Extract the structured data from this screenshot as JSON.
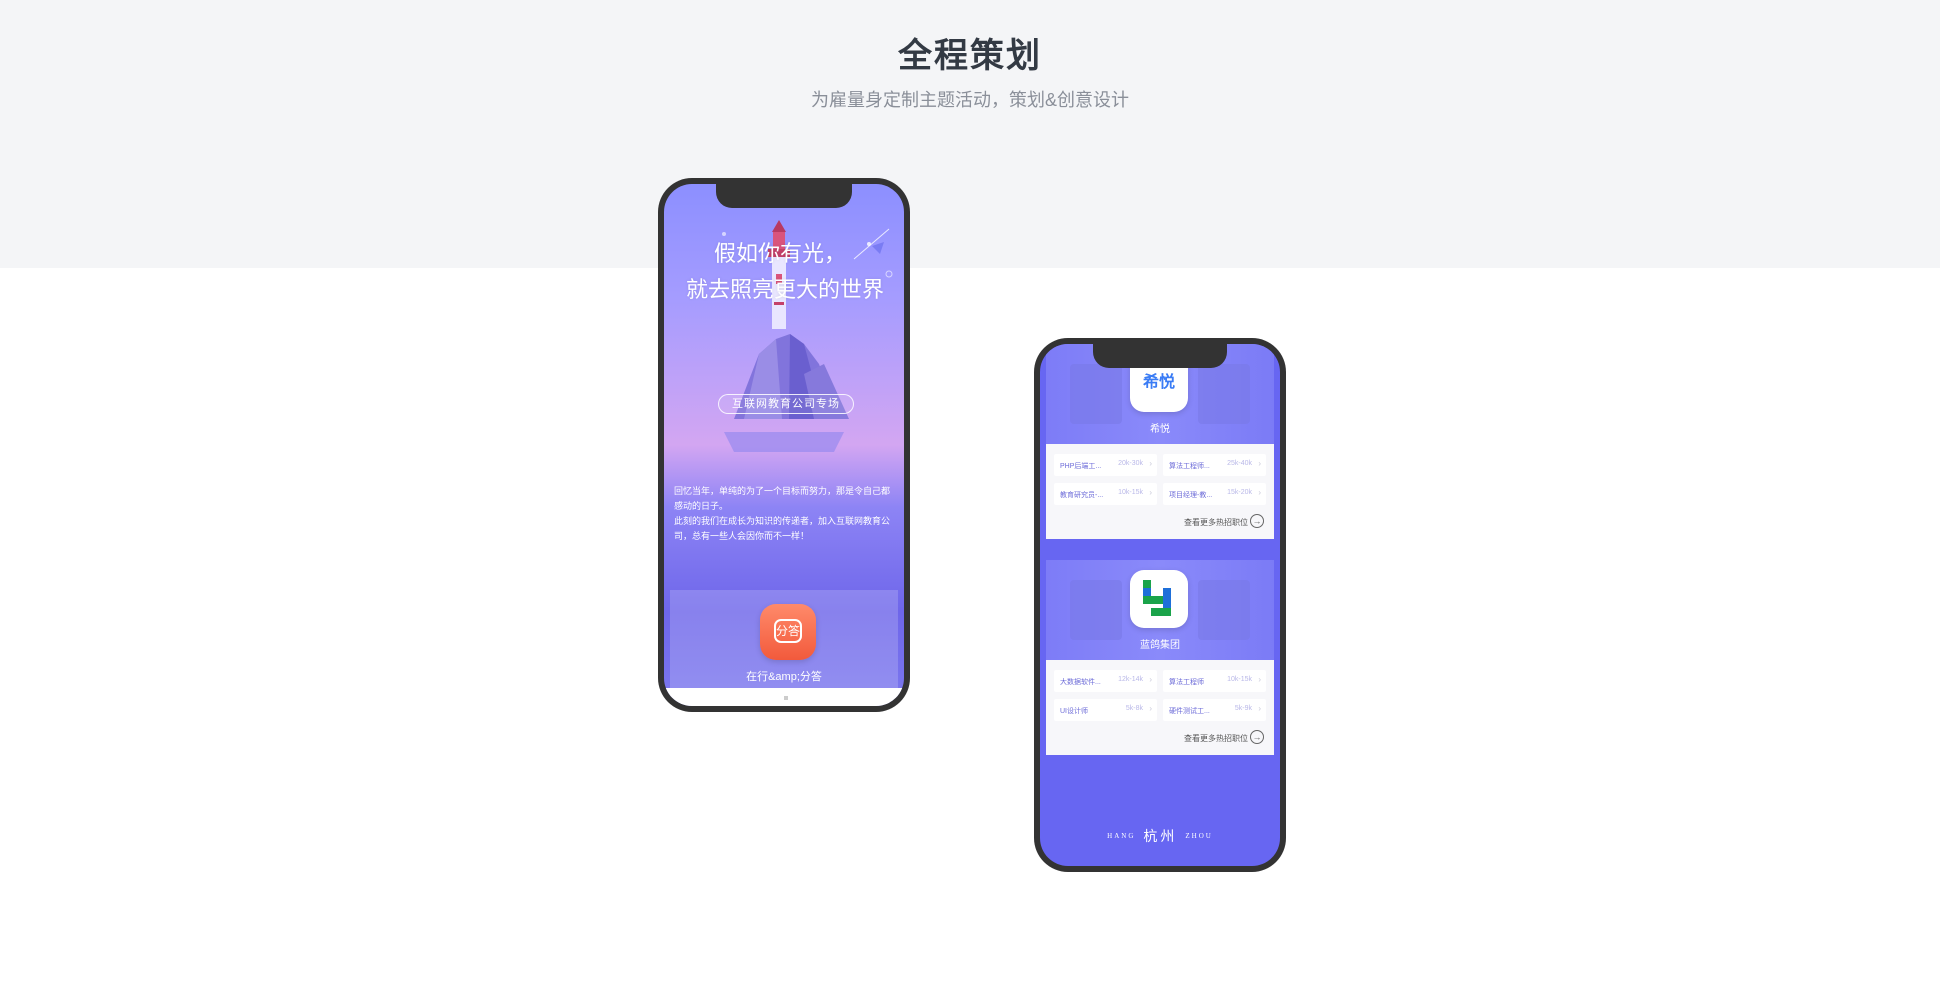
{
  "section": {
    "title": "全程策划",
    "subtitle": "为雇量身定制主题活动，策划&创意设计"
  },
  "phone1": {
    "poem_line1": "假如你有光，",
    "poem_line2": "就去照亮更大的世界",
    "tag": "互联网教育公司专场",
    "intro": [
      "回忆当年，单纯的为了一个目标而努力，那是令自己都感动的日子。",
      "此刻的我们在成长为知识的传递者，加入互联网教育公司，总有一些人会因你而不一样！"
    ],
    "brand": {
      "icon_text": "分答",
      "name": "在行&amp;分答"
    }
  },
  "phone2": {
    "companies": [
      {
        "logo_text": "希悦",
        "name": "希悦",
        "jobs": [
          {
            "title": "PHP后端工...",
            "salary": "20k-30k"
          },
          {
            "title": "算法工程师...",
            "salary": "25k-40k"
          },
          {
            "title": "教育研究员-...",
            "salary": "10k-15k"
          },
          {
            "title": "项目经理-教...",
            "salary": "15k-20k"
          }
        ],
        "more": "查看更多热招职位"
      },
      {
        "logo_text": "",
        "name": "蓝鸽集团",
        "jobs": [
          {
            "title": "大数据软件...",
            "salary": "12k-14k"
          },
          {
            "title": "算法工程师",
            "salary": "10k-15k"
          },
          {
            "title": "UI设计师",
            "salary": "5k-8k"
          },
          {
            "title": "硬件测试工...",
            "salary": "5k-9k"
          }
        ],
        "more": "查看更多热招职位"
      }
    ],
    "city": {
      "left": "HANG",
      "center": "杭州",
      "right": "ZHOU"
    }
  },
  "colors": {
    "background_band": "#f4f5f7",
    "title": "#333a44",
    "subtitle": "#8a8f99",
    "phone_frame": "#333333",
    "accent_purple": "#6766f2",
    "brand_orange": "#f25a3c"
  },
  "icons": [
    "lighthouse-illustration",
    "fenda-app-icon",
    "xiyue-logo",
    "languo-logo",
    "arrow-right-circle-icon",
    "chevron-right-icon"
  ]
}
